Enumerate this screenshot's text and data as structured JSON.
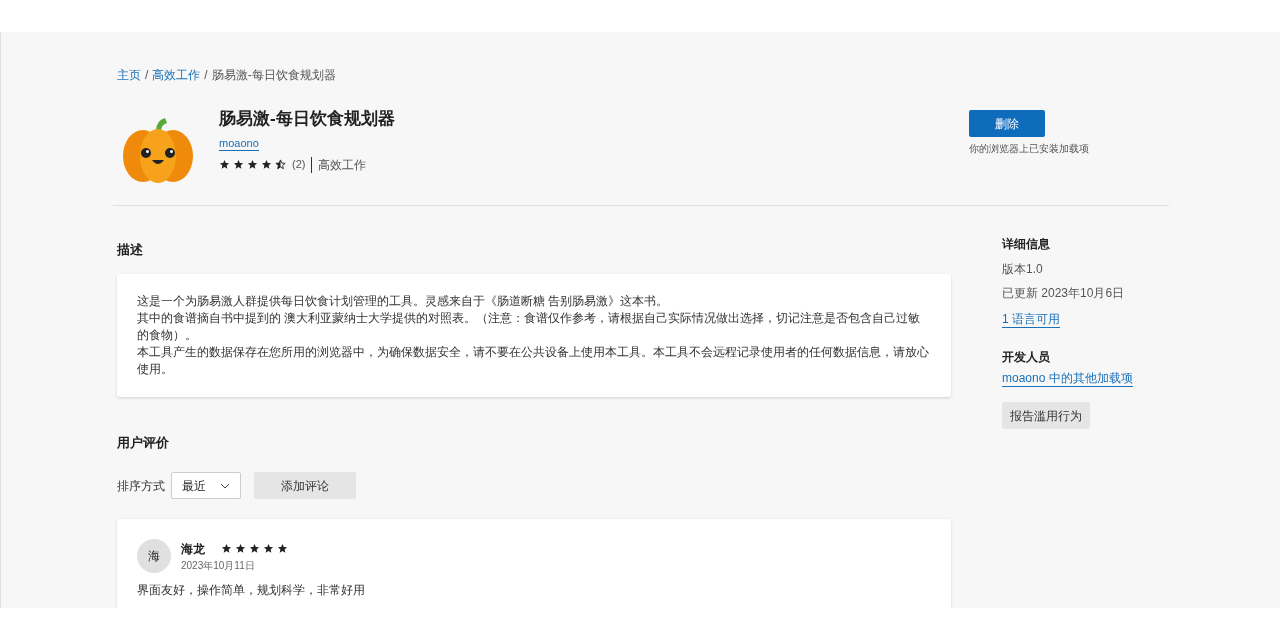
{
  "breadcrumb": [
    {
      "label": "主页",
      "link": true
    },
    {
      "separator": "/",
      "label": "高效工作",
      "link": true
    },
    {
      "separator": "/",
      "label": "肠易激-每日饮食规划器",
      "link": false
    }
  ],
  "addon": {
    "title": "肠易激-每日饮食规划器",
    "author": "moaono",
    "stars": 4.5,
    "rating_count": "(2)",
    "category": "高效工作",
    "remove_button": "删除",
    "installed_note": "你的浏览器上已安装加载项"
  },
  "description": {
    "heading": "描述",
    "paragraphs": [
      "这是一个为肠易激人群提供每日饮食计划管理的工具。灵感来自于《肠道断糖 告别肠易激》这本书。",
      "其中的食谱摘自书中提到的 澳大利亚蒙纳士大学提供的对照表。（注意：食谱仅作参考，请根据自己实际情况做出选择，切记注意是否包含自己过敏的食物）。",
      "本工具产生的数据保存在您所用的浏览器中，为确保数据安全，请不要在公共设备上使用本工具。本工具不会远程记录使用者的任何数据信息，请放心使用。"
    ]
  },
  "details": {
    "heading": "详细信息",
    "version": "版本1.0",
    "updated": "已更新 2023年10月6日",
    "languages_link": "1 语言可用",
    "developer_heading": "开发人员",
    "developer_link": "moaono 中的其他加载项",
    "report_button": "报告滥用行为"
  },
  "reviews": {
    "heading": "用户评价",
    "sort_label": "排序方式",
    "sort_value": "最近",
    "add_button": "添加评论",
    "items": [
      {
        "avatar": "海",
        "name": "海龙",
        "stars": 5,
        "date": "2023年10月11日",
        "text": "界面友好，操作简单，规划科学，非常好用"
      }
    ]
  }
}
